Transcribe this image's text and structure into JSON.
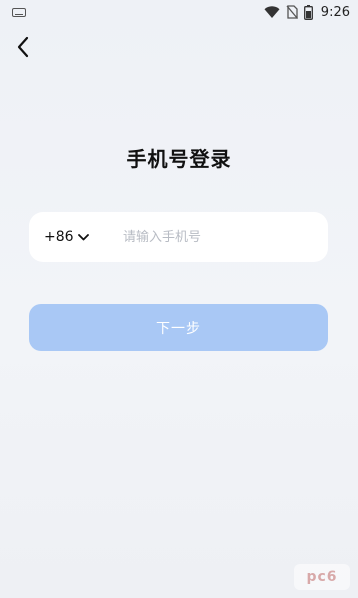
{
  "status_bar": {
    "time": "9:26",
    "icons": [
      "keyboard-icon",
      "wifi-icon",
      "no-sim-icon",
      "battery-icon"
    ]
  },
  "header": {
    "back_icon": "chevron-left-icon"
  },
  "title": "手机号登录",
  "phone": {
    "country_code": "+86",
    "placeholder": "请输入手机号",
    "value": ""
  },
  "next_button_label": "下一步",
  "watermark": "pc6",
  "colors": {
    "accent_disabled": "#a9c8f5",
    "background": "#eef1f6",
    "input_bg": "#ffffff",
    "placeholder": "#b8bcc4"
  }
}
